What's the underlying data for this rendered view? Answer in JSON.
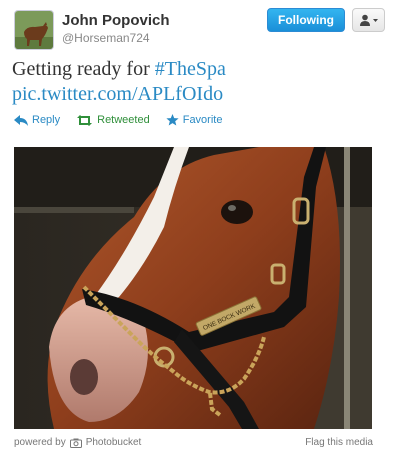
{
  "user": {
    "full_name": "John Popovich",
    "username": "@Horseman724",
    "avatar_icon": "horse-avatar-icon"
  },
  "buttons": {
    "follow_label": "Following",
    "user_menu_icon": "person-dropdown-icon"
  },
  "tweet": {
    "text_prefix": "Getting ready for ",
    "hashtag": "#TheSpa",
    "link": "pic.twitter.com/APLfOIdo"
  },
  "actions": {
    "reply": "Reply",
    "retweet": "Retweeted",
    "favorite": "Favorite"
  },
  "media": {
    "image_icon": "horse-photo",
    "nameplate_text": "ONE BOCK WORK"
  },
  "footer": {
    "powered_prefix": "powered by",
    "provider": "Photobucket",
    "flag_link": "Flag this media"
  },
  "colors": {
    "link": "#2a8ac4",
    "retweet": "#2f8f3a",
    "follow_button": "#1a8fd8"
  }
}
